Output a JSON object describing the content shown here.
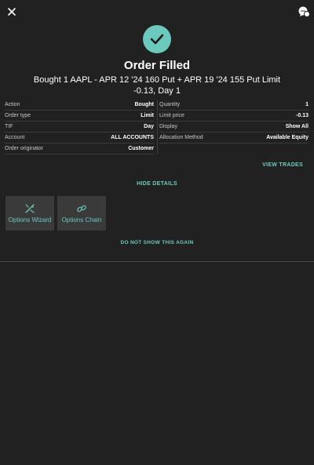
{
  "header": {
    "title": "Order Filled",
    "description": "Bought 1 AAPL - APR 12 '24 160 Put + APR 19 '24 155 Put Limit -0.13, Day 1"
  },
  "details_left": [
    {
      "label": "Action",
      "value": "Bought"
    },
    {
      "label": "Order type",
      "value": "Limit"
    },
    {
      "label": "TIF",
      "value": "Day"
    },
    {
      "label": "Account",
      "value": "ALL ACCOUNTS"
    },
    {
      "label": "Order originator",
      "value": "Customer"
    }
  ],
  "details_right": [
    {
      "label": "Quantity",
      "value": "1"
    },
    {
      "label": "Limit price",
      "value": "-0.13"
    },
    {
      "label": "Display",
      "value": "Show All"
    },
    {
      "label": "Allocation Method",
      "value": "Available Equity"
    }
  ],
  "links": {
    "view_trades": "VIEW TRADES",
    "hide_details": "HIDE DETAILS",
    "dont_show": "DO NOT SHOW THIS AGAIN"
  },
  "tiles": [
    {
      "label": "Options Wizard",
      "icon": "wand-icon"
    },
    {
      "label": "Options Chain",
      "icon": "link-icon"
    }
  ],
  "colors": {
    "background": "#212121",
    "accent": "#6cc9bd",
    "tile": "#3a3a3a"
  }
}
